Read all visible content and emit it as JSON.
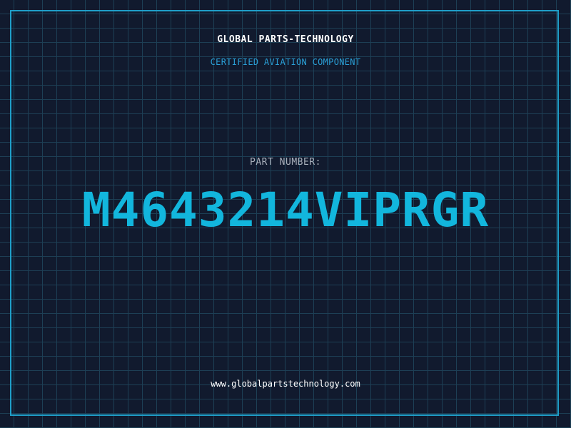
{
  "header": {
    "company": "GLOBAL PARTS-TECHNOLOGY",
    "tagline": "CERTIFIED AVIATION COMPONENT"
  },
  "part": {
    "label": "PART NUMBER:",
    "number": "M4643214VIPRGR"
  },
  "footer": {
    "website": "www.globalpartstechnology.com"
  },
  "colors": {
    "background": "#111a2e",
    "grid": "#1d3f55",
    "accent": "#12b6dd",
    "border": "#1f9fc9",
    "label": "#a9b0bb"
  }
}
